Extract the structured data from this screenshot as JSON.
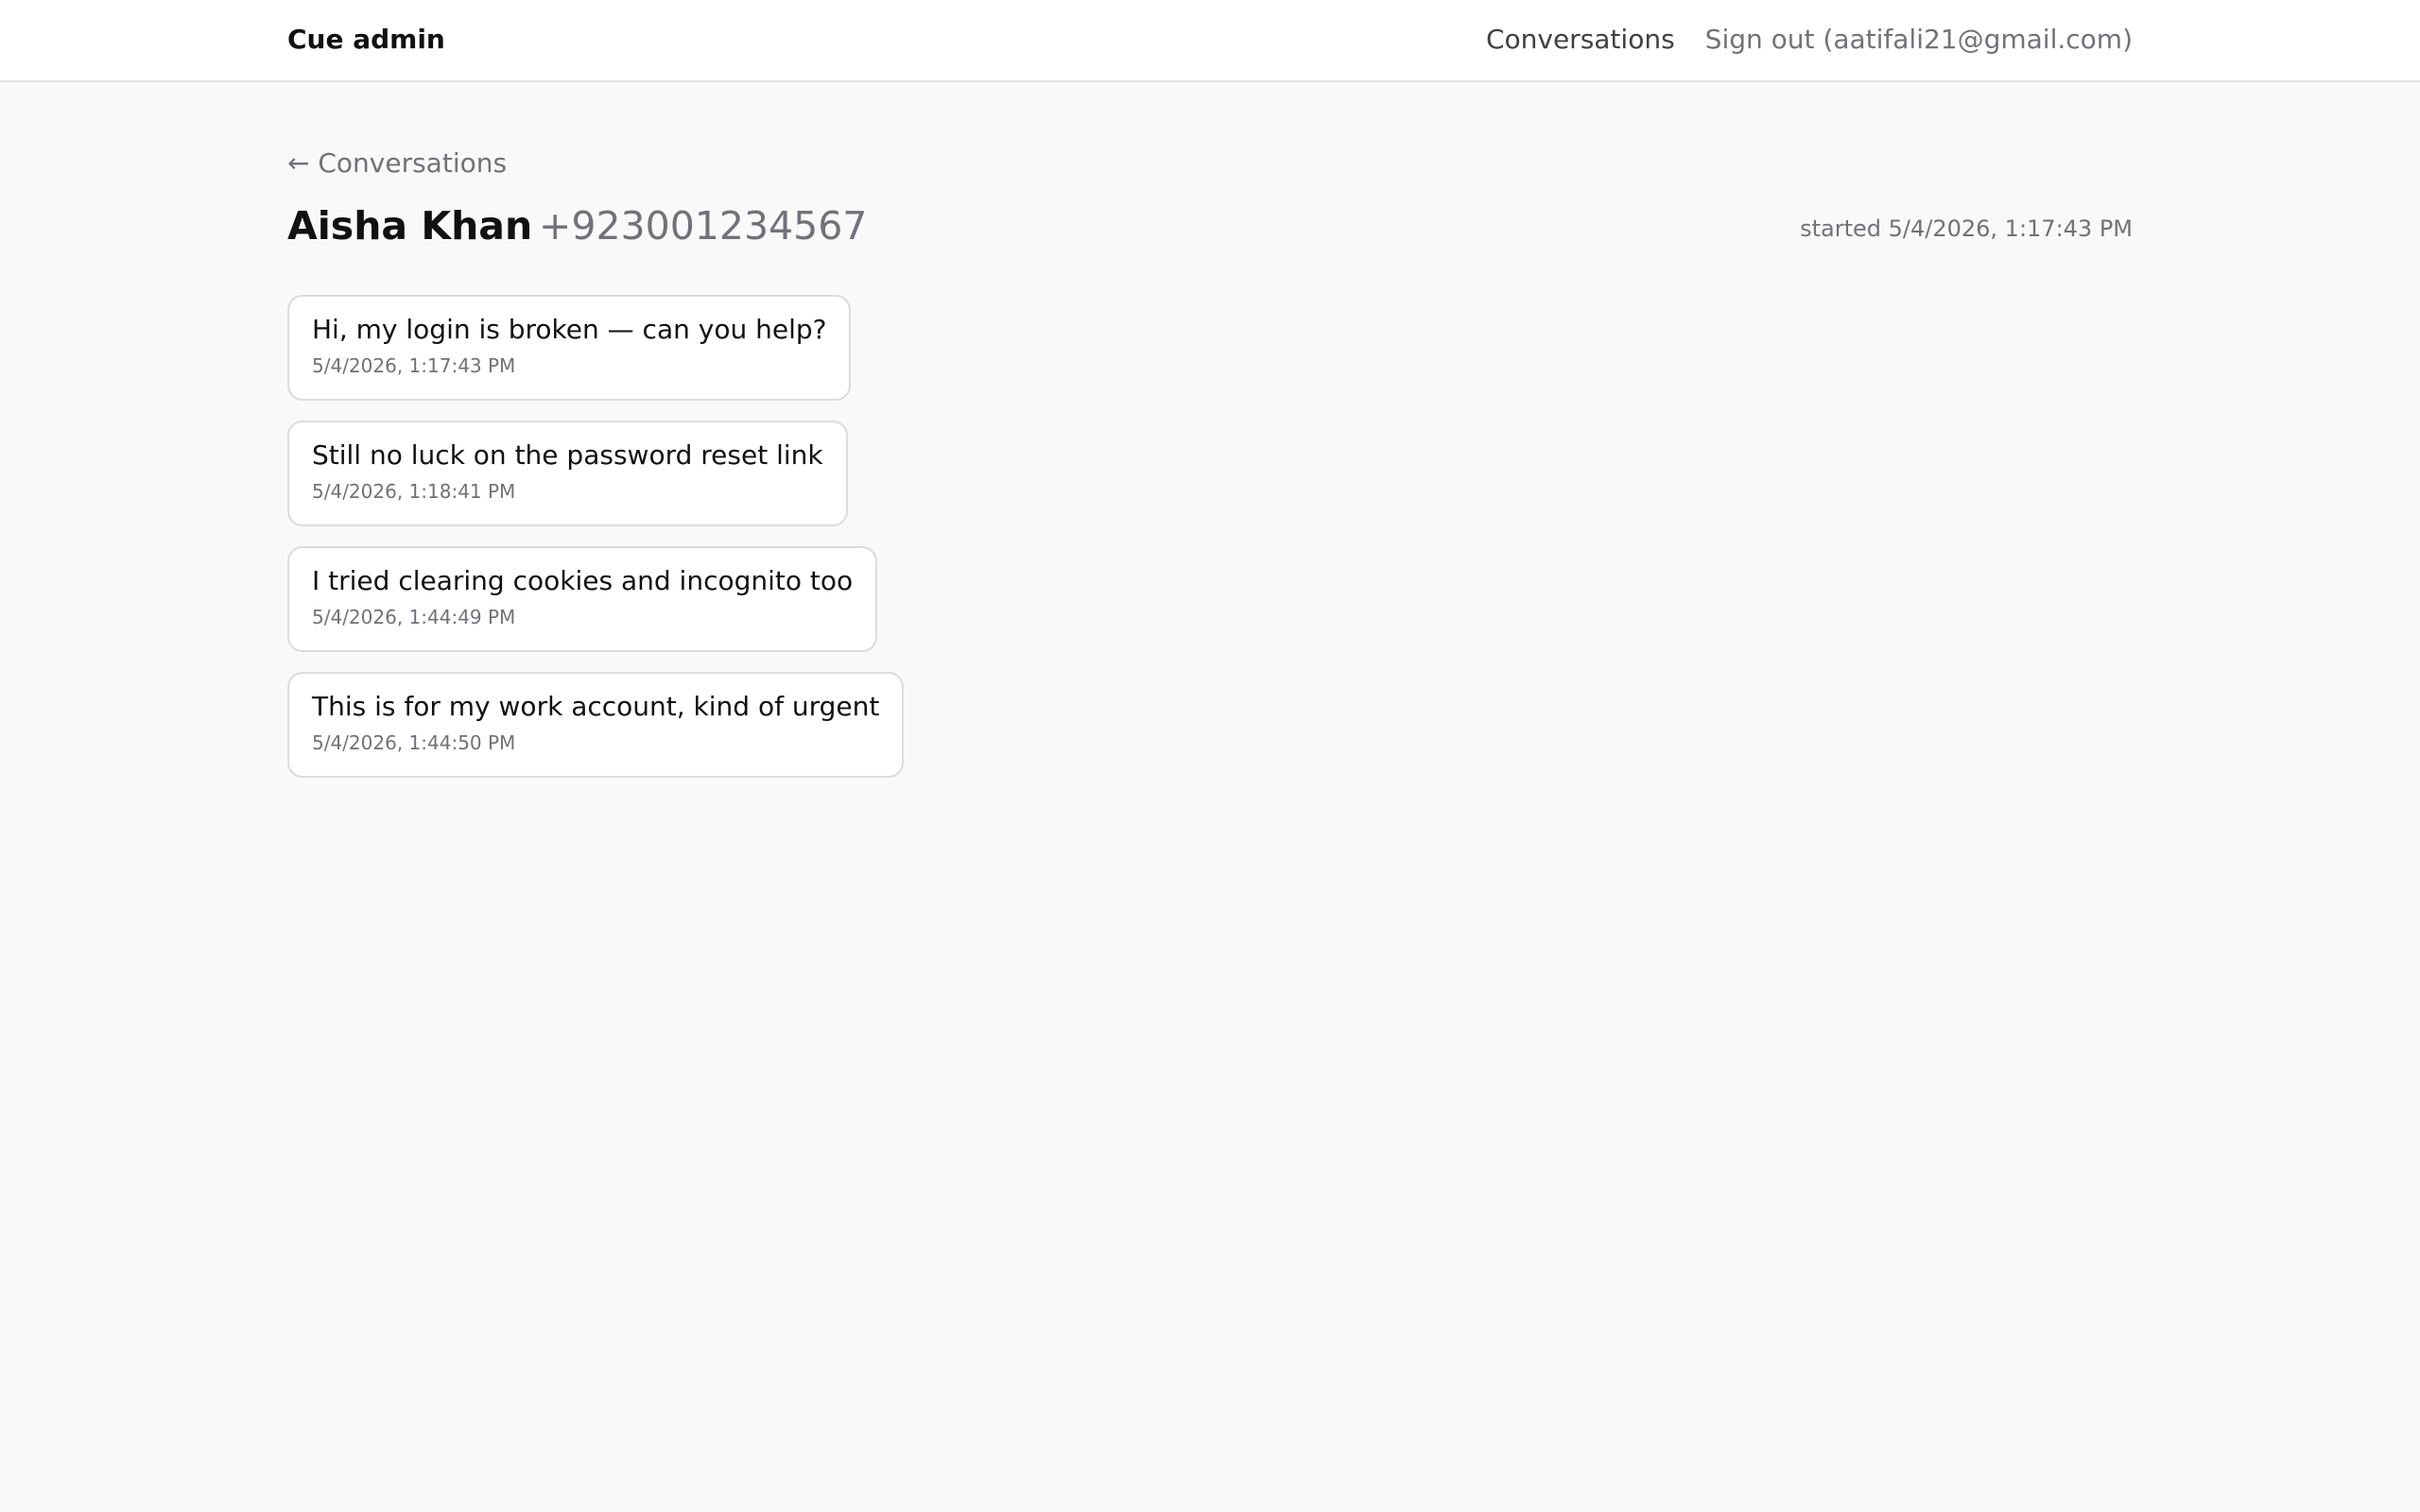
{
  "header": {
    "brand": "Cue admin",
    "nav": {
      "conversations_label": "Conversations",
      "signout_label": "Sign out (aatifali21@gmail.com)"
    }
  },
  "conversation": {
    "back_label": "← Conversations",
    "contact_name": "Aisha Khan",
    "contact_phone": "+923001234567",
    "started_label": "started 5/4/2026, 1:17:43 PM",
    "messages": [
      {
        "text": "Hi, my login is broken — can you help?",
        "timestamp": "5/4/2026, 1:17:43 PM"
      },
      {
        "text": "Still no luck on the password reset link",
        "timestamp": "5/4/2026, 1:18:41 PM"
      },
      {
        "text": "I tried clearing cookies and incognito too",
        "timestamp": "5/4/2026, 1:44:49 PM"
      },
      {
        "text": "This is for my work account, kind of urgent",
        "timestamp": "5/4/2026, 1:44:50 PM"
      }
    ]
  },
  "colors": {
    "page_background": "#f9f9f9",
    "topbar_background": "#ffffff",
    "muted_text": "#71717a",
    "bubble_border": "#dcdce0"
  }
}
